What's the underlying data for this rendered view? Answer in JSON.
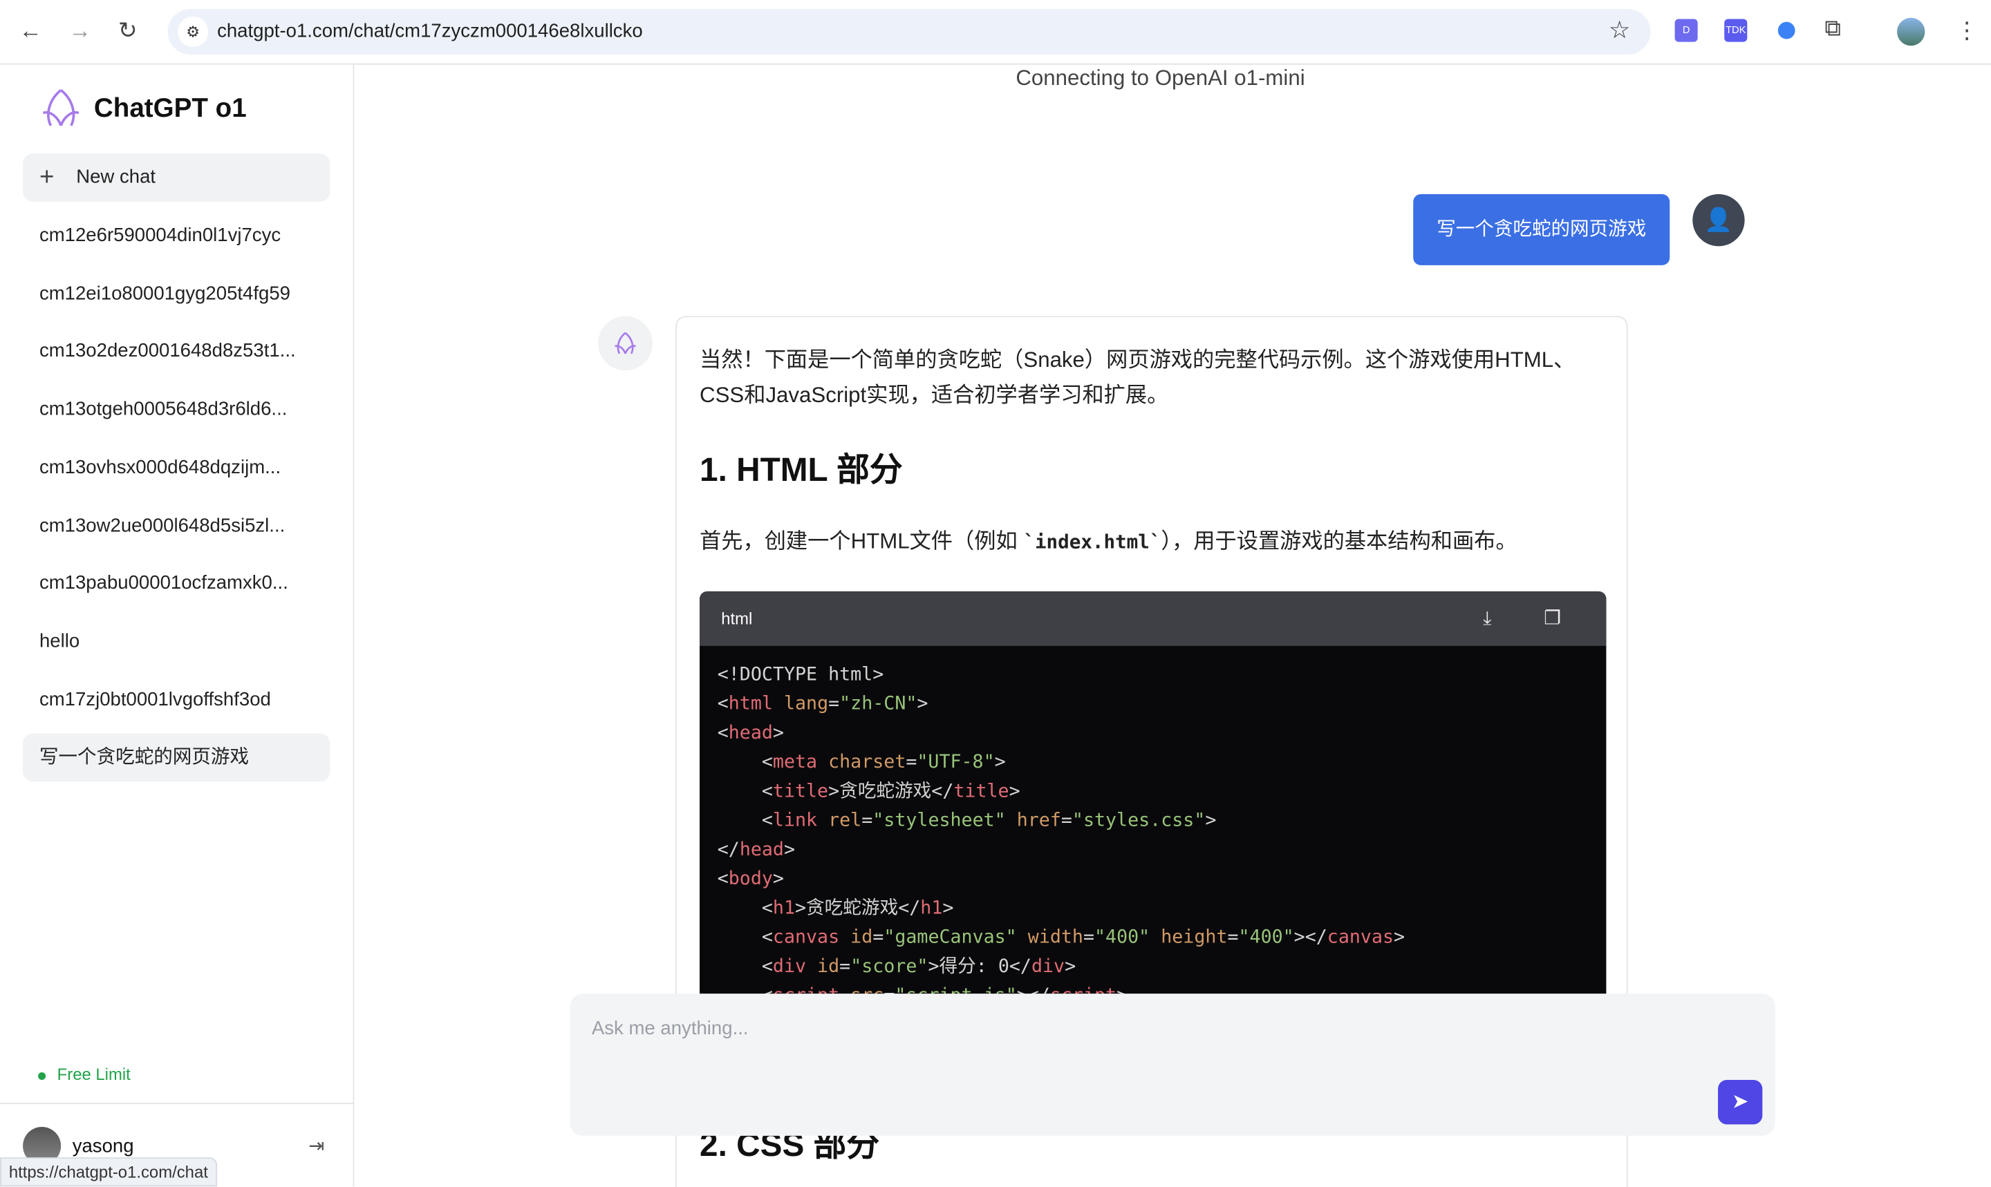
{
  "browser": {
    "url": "chatgpt-o1.com/chat/cm17zyczm000146e8lxullcko",
    "status_url": "https://chatgpt-o1.com/chat",
    "ext_tdk": "TDK"
  },
  "sidebar": {
    "brand": "ChatGPT o1",
    "new_chat": "New chat",
    "history": [
      "cm12e6r590004din0l1vj7cyc",
      "cm12ei1o80001gyg205t4fg59",
      "cm13o2dez0001648d8z53t1...",
      "cm13otgeh0005648d3r6ld6...",
      "cm13ovhsx000d648dqzijm...",
      "cm13ow2ue000l648d5si5zl...",
      "cm13pabu00001ocfzamxk0...",
      "hello",
      "cm17zj0bt0001lvgoffshf3od",
      "写一个贪吃蛇的网页游戏"
    ],
    "free_limit": "Free Limit",
    "user": "yasong"
  },
  "main": {
    "connecting": "Connecting to OpenAI o1-mini",
    "user_message": "写一个贪吃蛇的网页游戏",
    "reply": {
      "intro": "当然！下面是一个简单的贪吃蛇（Snake）网页游戏的完整代码示例。这个游戏使用HTML、CSS和JavaScript实现，适合初学者学习和扩展。",
      "h1": "1. HTML 部分",
      "p_before": "首先，创建一个HTML文件（例如 ",
      "p_code": "`index.html`",
      "p_after": "），用于设置游戏的基本结构和画布。",
      "code_lang": "html",
      "h2": "2. CSS 部分"
    },
    "input_placeholder": "Ask me anything..."
  },
  "colors": {
    "accent": "#3b6fe4",
    "send": "#4f46e5",
    "free": "#22a34a"
  }
}
